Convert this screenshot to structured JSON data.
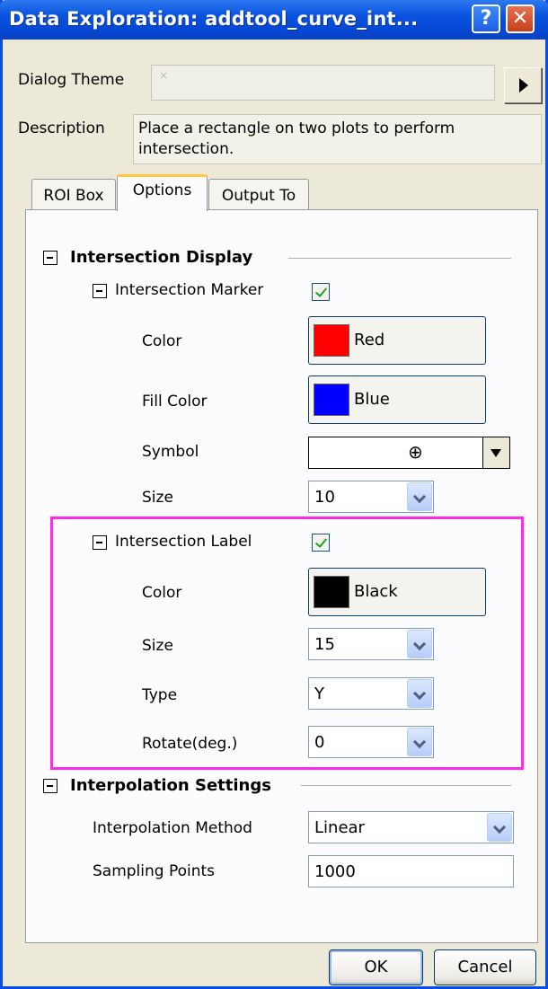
{
  "window": {
    "title": "Data Exploration: addtool_curve_int...",
    "help_label": "?",
    "close_label": "✕"
  },
  "dialog_theme": {
    "label": "Dialog Theme",
    "value": ""
  },
  "description": {
    "label": "Description",
    "text": "Place a rectangle on two plots to perform intersection."
  },
  "tabs": [
    {
      "label": "ROI Box",
      "active": false
    },
    {
      "label": "Options",
      "active": true
    },
    {
      "label": "Output To",
      "active": false
    }
  ],
  "intersection_display": {
    "title": "Intersection Display",
    "marker": {
      "title": "Intersection Marker",
      "enabled": true,
      "color_label": "Color",
      "color_value": "Red",
      "color_hex": "#ff0000",
      "fill_label": "Fill Color",
      "fill_value": "Blue",
      "fill_hex": "#0000ff",
      "symbol_label": "Symbol",
      "symbol_value": "⊕",
      "size_label": "Size",
      "size_value": "10"
    },
    "label": {
      "title": "Intersection Label",
      "enabled": true,
      "color_label": "Color",
      "color_value": "Black",
      "color_hex": "#000000",
      "size_label": "Size",
      "size_value": "15",
      "type_label": "Type",
      "type_value": "Y",
      "rotate_label": "Rotate(deg.)",
      "rotate_value": "0"
    }
  },
  "interpolation": {
    "title": "Interpolation Settings",
    "method_label": "Interpolation Method",
    "method_value": "Linear",
    "points_label": "Sampling Points",
    "points_value": "1000"
  },
  "buttons": {
    "ok": "OK",
    "cancel": "Cancel"
  },
  "colors": {
    "highlight": "#ff2bea",
    "title_bar": "#0a52df",
    "active_tab_accent": "#ffc83c"
  }
}
